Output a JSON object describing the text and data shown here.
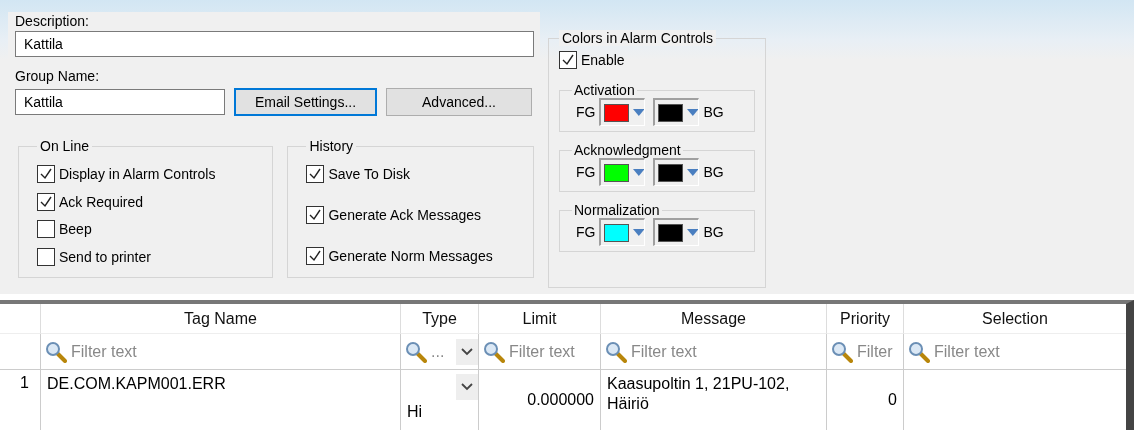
{
  "description": {
    "label": "Description:",
    "value": "Kattila"
  },
  "group_name": {
    "label": "Group Name:",
    "value": "Kattila"
  },
  "buttons": [
    {
      "label": "Email Settings...",
      "focused": true
    },
    {
      "label": "Advanced...",
      "focused": false
    }
  ],
  "online": {
    "title": "On Line",
    "options": [
      {
        "label": "Display in Alarm Controls",
        "checked": true
      },
      {
        "label": "Ack Required",
        "checked": true
      },
      {
        "label": "Beep",
        "checked": false
      },
      {
        "label": "Send to printer",
        "checked": false
      }
    ]
  },
  "history": {
    "title": "History",
    "options": [
      {
        "label": "Save To Disk",
        "checked": true
      },
      {
        "label": "Generate Ack Messages",
        "checked": true
      },
      {
        "label": "Generate Norm Messages",
        "checked": true
      }
    ]
  },
  "colors": {
    "title": "Colors in Alarm Controls",
    "enable": {
      "label": "Enable",
      "checked": true
    },
    "groups": [
      {
        "title": "Activation",
        "fg": {
          "label": "FG",
          "color": "#ff0000"
        },
        "bg": {
          "label": "BG",
          "color": "#000000"
        }
      },
      {
        "title": "Acknowledgment",
        "fg": {
          "label": "FG",
          "color": "#00ff00"
        },
        "bg": {
          "label": "BG",
          "color": "#000000"
        }
      },
      {
        "title": "Normalization",
        "fg": {
          "label": "FG",
          "color": "#00ffff"
        },
        "bg": {
          "label": "BG",
          "color": "#000000"
        }
      }
    ]
  },
  "table": {
    "columns": [
      {
        "header": "Tag Name",
        "filter": "Filter text",
        "kind": "text"
      },
      {
        "header": "Type",
        "filter": "...",
        "kind": "dropdown"
      },
      {
        "header": "Limit",
        "filter": "Filter text",
        "kind": "number"
      },
      {
        "header": "Message",
        "filter": "Filter text",
        "kind": "text"
      },
      {
        "header": "Priority",
        "filter": "Filter",
        "kind": "number"
      },
      {
        "header": "Selection",
        "filter": "Filter text",
        "kind": "text"
      }
    ],
    "rows": [
      {
        "number": "1",
        "cells": [
          "DE.COM.KAPM001.ERR",
          "Hi",
          "0.000000",
          "Kaasupoltin 1, 21PU-102, Häiriö",
          "0"
        ]
      }
    ]
  }
}
